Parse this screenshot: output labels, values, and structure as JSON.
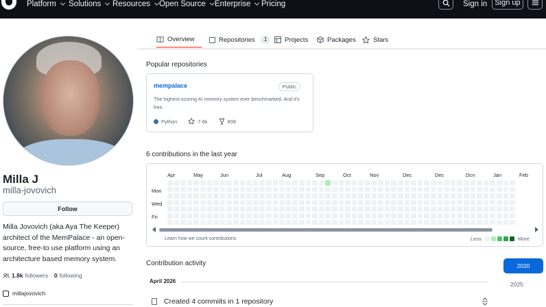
{
  "nav": {
    "items": [
      "Platform",
      "Solutions",
      "Resources",
      "Open Source",
      "Enterprise",
      "Pricing"
    ],
    "sign_in": "Sign in",
    "sign_up": "Sign up"
  },
  "tabs": [
    {
      "label": "Overview"
    },
    {
      "label": "Repositories",
      "count": "1"
    },
    {
      "label": "Projects"
    },
    {
      "label": "Packages"
    },
    {
      "label": "Stars"
    }
  ],
  "profile": {
    "name": "Milla J",
    "username": "milla-jovovich",
    "follow_label": "Follow",
    "bio": "Milla Jovovich (aka Aya The Keeper) architect of the MemPalace - an open-source, free-to use platform using an architecture based memory system.",
    "followers_count": "1.8k",
    "followers_label": "followers",
    "dot": "·",
    "following_count": "0",
    "following_label": "following",
    "social": "millajovovich"
  },
  "popular": {
    "title": "Popular repositories",
    "repo": {
      "name": "mempalace",
      "visibility": "Public",
      "description": "The highest-scoring AI memory system ever benchmarked. And it's free.",
      "language": "Python",
      "language_color": "#3572a5",
      "stars": "7.6k",
      "forks": "808"
    }
  },
  "contributions": {
    "title": "6 contributions in the last year",
    "months": [
      "Apr",
      "May",
      "Jun",
      "Jul",
      "Aug",
      "Sep",
      "Oct",
      "Nov",
      "Dec",
      "Dec",
      "Dcn",
      "Jan",
      "Feb"
    ],
    "days": [
      "Mon",
      "Wed",
      "Fri"
    ],
    "learn_link": "Learn how we count contributions",
    "legend_less": "Less",
    "legend_more": "More",
    "legend_colors": [
      "#eff2f5",
      "#aceebb",
      "#4ac26b",
      "#2da44e",
      "#116329"
    ]
  },
  "activity": {
    "title": "Contribution activity",
    "month": "April 2026",
    "entry": "Created 4 commiits in 1 repository",
    "years": [
      "2020",
      "2025"
    ]
  }
}
